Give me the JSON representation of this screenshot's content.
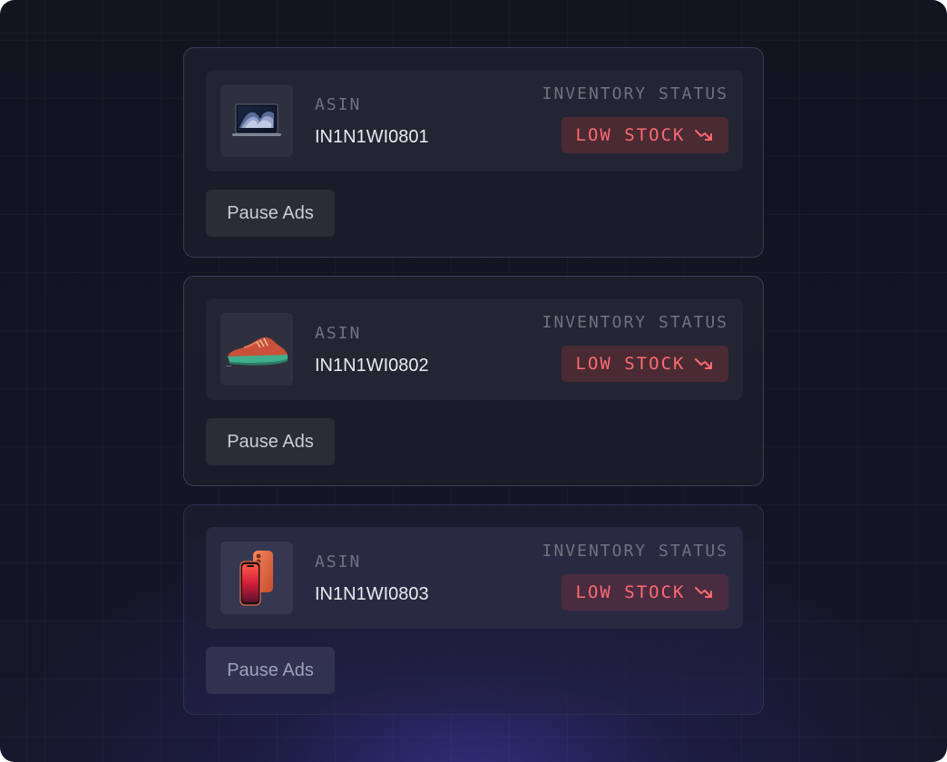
{
  "colors": {
    "background": "#131524",
    "card": "#1b1d2a",
    "badge_bg": "#4a2a33",
    "badge_text": "#ff6a70",
    "accent_glow": "#3a3496"
  },
  "products": [
    {
      "image_icon": "laptop-icon",
      "asin_label": "ASIN",
      "asin": "IN1N1WI0801",
      "inventory_label": "INVENTORY STATUS",
      "status": "LOW STOCK",
      "status_icon": "trending-down-icon",
      "action_label": "Pause Ads"
    },
    {
      "image_icon": "sneaker-icon",
      "asin_label": "ASIN",
      "asin": "IN1N1WI0802",
      "inventory_label": "INVENTORY STATUS",
      "status": "LOW STOCK",
      "status_icon": "trending-down-icon",
      "action_label": "Pause Ads"
    },
    {
      "image_icon": "smartphone-icon",
      "asin_label": "ASIN",
      "asin": "IN1N1WI0803",
      "inventory_label": "INVENTORY STATUS",
      "status": "LOW STOCK",
      "status_icon": "trending-down-icon",
      "action_label": "Pause Ads"
    }
  ]
}
